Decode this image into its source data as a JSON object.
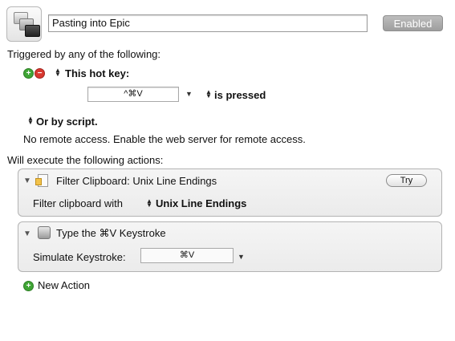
{
  "macro": {
    "name": "Pasting into Epic",
    "status_button": "Enabled"
  },
  "triggers": {
    "heading": "Triggered by any of the following:",
    "add_symbol": "+",
    "remove_symbol": "−",
    "hotkey_type": "This hot key:",
    "hotkey_value": "^⌘V",
    "hotkey_condition": "is pressed",
    "script_option": "Or by script.",
    "remote_note": "No remote access.  Enable the web server for remote access."
  },
  "actions": {
    "heading": "Will execute the following actions:",
    "items": [
      {
        "title": "Filter Clipboard: Unix Line Endings",
        "try_label": "Try",
        "param_label": "Filter clipboard with",
        "param_value": "Unix Line Endings"
      },
      {
        "title": "Type the ⌘V Keystroke",
        "param_label": "Simulate Keystroke:",
        "param_value": "⌘V"
      }
    ],
    "new_action": "New Action"
  }
}
